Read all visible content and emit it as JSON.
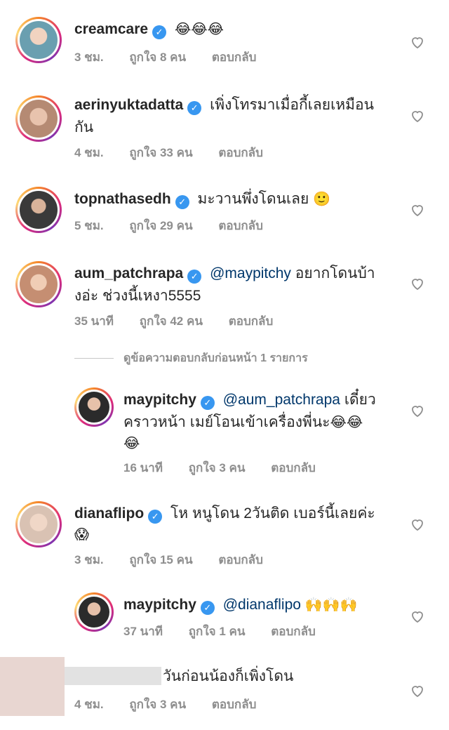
{
  "comments": [
    {
      "username": "creamcare",
      "text": "",
      "emoji": "😂😂😂",
      "time": "3 ชม.",
      "likes": "ถูกใจ 8 คน",
      "reply": "ตอบกลับ",
      "avatar_color": "#6a9fb0"
    },
    {
      "username": "aerinyuktadatta",
      "text": "เพิ่งโทรมาเมื่อกี้เลยเหมือน",
      "text2": "กัน",
      "time": "4 ชม.",
      "likes": "ถูกใจ 33 คน",
      "reply": "ตอบกลับ",
      "avatar_color": "#c9a08a"
    },
    {
      "username": "topnathasedh",
      "text": "มะวานพึ่งโดนเลย",
      "emoji": "🙂",
      "time": "5 ชม.",
      "likes": "ถูกใจ 29 คน",
      "reply": "ตอบกลับ",
      "avatar_color": "#3a3a3a"
    },
    {
      "username": "aum_patchrapa",
      "mention": "@maypitchy",
      "text": "อยากโดนบ้า",
      "text2": "งอ่ะ ช่วงนี้เหงา5555",
      "time": "35 นาที",
      "likes": "ถูกใจ 42 คน",
      "reply": "ตอบกลับ",
      "avatar_color": "#d8a58a"
    },
    {
      "username": "maypitchy",
      "mention": "@aum_patchrapa",
      "text": "เดี๋ยว",
      "text2": "คราวหน้า เมย์โอนเข้าเครื่องพี่นะ",
      "emoji": "😂😂",
      "emoji2": "😂",
      "time": "16 นาที",
      "likes": "ถูกใจ 3 คน",
      "reply": "ตอบกลับ",
      "avatar_color": "#2b2b2b"
    },
    {
      "username": "dianaflipo",
      "text": "โห หนูโดน 2วันติด เบอร์นี้เลยค่ะ",
      "emoji2": "😱",
      "time": "3 ชม.",
      "likes": "ถูกใจ 15 คน",
      "reply": "ตอบกลับ",
      "avatar_color": "#d9c2b3"
    },
    {
      "username": "maypitchy",
      "mention": "@dianaflipo",
      "emoji": "🙌🙌🙌",
      "time": "37 นาที",
      "likes": "ถูกใจ 1 คน",
      "reply": "ตอบกลับ",
      "avatar_color": "#2b2b2b"
    },
    {
      "username": "",
      "text": "วันก่อนน้องก็เพิ่งโดน",
      "time": "4 ชม.",
      "likes": "ถูกใจ 3 คน",
      "reply": "ตอบกลับ"
    }
  ],
  "view_previous_replies": "ดูข้อความตอบกลับก่อนหน้า 1 รายการ",
  "verified_mark": "✓"
}
